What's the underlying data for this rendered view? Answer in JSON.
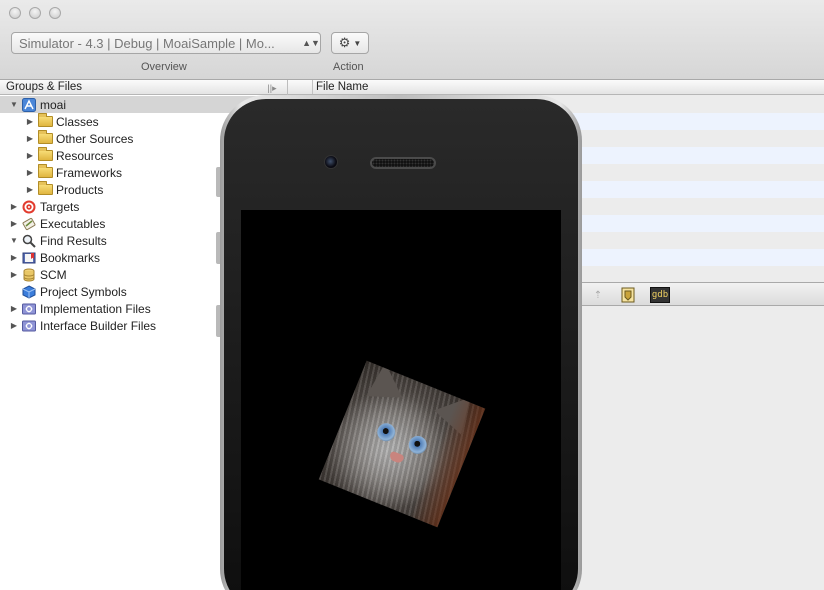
{
  "toolbar": {
    "scheme_label": "Simulator - 4.3 | Debug | MoaiSample | Mo...",
    "overview_caption": "Overview",
    "action_caption": "Action",
    "action_icon": "gear-icon"
  },
  "sidebar": {
    "header": "Groups & Files",
    "items": [
      {
        "label": "moai",
        "icon": "xcode-project-icon",
        "expanded": true,
        "selected": true
      },
      {
        "label": "Classes",
        "icon": "folder-icon"
      },
      {
        "label": "Other Sources",
        "icon": "folder-icon"
      },
      {
        "label": "Resources",
        "icon": "folder-icon"
      },
      {
        "label": "Frameworks",
        "icon": "folder-icon"
      },
      {
        "label": "Products",
        "icon": "folder-icon"
      },
      {
        "label": "Targets",
        "icon": "target-icon"
      },
      {
        "label": "Executables",
        "icon": "executables-icon"
      },
      {
        "label": "Find Results",
        "icon": "magnifier-icon",
        "expanded": true
      },
      {
        "label": "Bookmarks",
        "icon": "bookmarks-icon"
      },
      {
        "label": "SCM",
        "icon": "scm-icon"
      },
      {
        "label": "Project Symbols",
        "icon": "cube-icon"
      },
      {
        "label": "Implementation Files",
        "icon": "smart-group-icon"
      },
      {
        "label": "Interface Builder Files",
        "icon": "smart-group-icon"
      }
    ]
  },
  "detail": {
    "column_header": "File Name"
  },
  "editor_bar": {
    "gdb_label": "gdb"
  },
  "colors": {
    "selection": "#d5d5d5",
    "stripe": "#edf3fe"
  }
}
